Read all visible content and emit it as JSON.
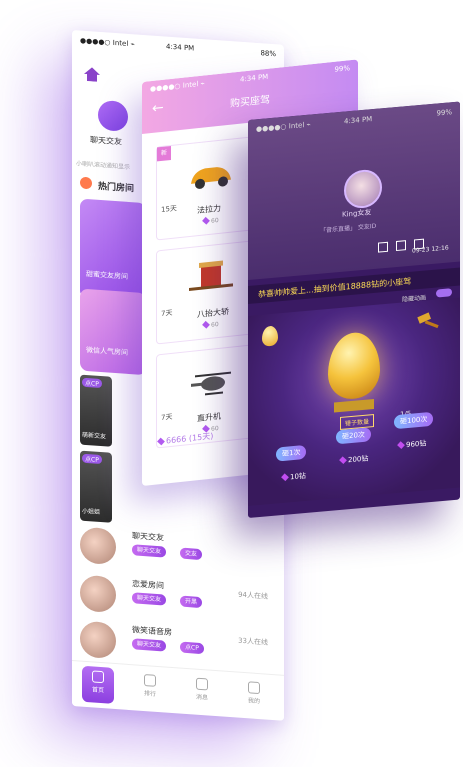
{
  "home": {
    "status": {
      "carrier": "●●●●○ Intel ⌁",
      "time": "4:34 PM",
      "battery": "88%"
    },
    "category_label": "聊天交友",
    "notice": "小喇叭滚动通知显示",
    "hot_title": "热门房间",
    "rooms": [
      "甜蜜交友房间",
      "微信人气房间"
    ],
    "tiles": [
      {
        "tag": "点CP",
        "cap": "萌新交友"
      },
      {
        "tag": "点CP",
        "cap": "小姐姐"
      }
    ],
    "list": [
      {
        "title": "聊天交友",
        "chip1": "聊天交友",
        "chip2": "交友",
        "online": ""
      },
      {
        "title": "恋爱房间",
        "chip1": "聊天交友",
        "chip2": "开黑",
        "online": "94人在线"
      },
      {
        "title": "微笑语音房",
        "chip1": "聊天交友",
        "chip2": "点CP",
        "online": "33人在线"
      }
    ],
    "tabs": [
      "首页",
      "排行",
      "消息",
      "我的"
    ]
  },
  "shop": {
    "status": {
      "carrier": "●●●●○ Intel ⌁",
      "time": "4:34 PM",
      "battery": "99%"
    },
    "title": "购买座驾",
    "items": [
      {
        "count": "15天",
        "name": "法拉力",
        "price": "60",
        "tag": "新"
      },
      {
        "count": "7天",
        "name": "八抬大轿",
        "price": "60",
        "tag": ""
      },
      {
        "count": "7天",
        "name": "直升机",
        "price": "60",
        "tag": ""
      }
    ],
    "total": "6666 (15天)"
  },
  "game": {
    "status": {
      "carrier": "●●●●○ Intel ⌁",
      "time": "4:34 PM",
      "battery": "99%"
    },
    "host_name": "King女友",
    "host_sub": "「音乐直播」 交友ID",
    "date": "09-23 12:16",
    "ticker": "恭喜帅帅爱上...抽到价值18888钻的小座驾",
    "toggle_label": "隐藏动画",
    "hammer_label": "锤子数量",
    "hammer_count": "1/5",
    "options": [
      {
        "label": "砸1次",
        "cost": "10钻"
      },
      {
        "label": "砸20次",
        "cost": "200钻"
      },
      {
        "label": "砸100次",
        "cost": "960钻"
      }
    ],
    "colors": {
      "accent": "#a66cf4",
      "bg": "#3a1a63",
      "gold": "#f5c33c"
    }
  }
}
